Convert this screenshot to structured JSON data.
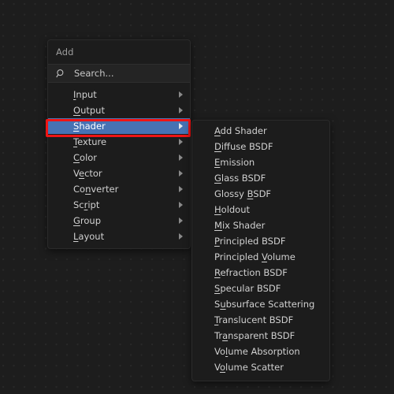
{
  "app": {
    "background_color": "#1d1d1d",
    "accent_color": "#4772b3",
    "highlight_color": "#f01414"
  },
  "add_menu": {
    "title": "Add",
    "search": {
      "icon": "search-icon",
      "placeholder": "Search...",
      "value": "Search..."
    },
    "items": [
      {
        "label": "Input",
        "acc": "I",
        "has_submenu": true,
        "selected": false
      },
      {
        "label": "Output",
        "acc": "O",
        "has_submenu": true,
        "selected": false
      },
      {
        "label": "Shader",
        "acc": "S",
        "has_submenu": true,
        "selected": true
      },
      {
        "label": "Texture",
        "acc": "T",
        "has_submenu": true,
        "selected": false
      },
      {
        "label": "Color",
        "acc": "C",
        "has_submenu": true,
        "selected": false
      },
      {
        "label": "Vector",
        "acc": "e",
        "has_submenu": true,
        "selected": false
      },
      {
        "label": "Converter",
        "acc": "n",
        "has_submenu": true,
        "selected": false
      },
      {
        "label": "Script",
        "acc": "r",
        "has_submenu": true,
        "selected": false
      },
      {
        "label": "Group",
        "acc": "G",
        "has_submenu": true,
        "selected": false
      },
      {
        "label": "Layout",
        "acc": "L",
        "has_submenu": true,
        "selected": false
      }
    ]
  },
  "shader_submenu": {
    "parent": "Shader",
    "items": [
      {
        "label": "Add Shader",
        "acc": "A"
      },
      {
        "label": "Diffuse BSDF",
        "acc": "D"
      },
      {
        "label": "Emission",
        "acc": "E"
      },
      {
        "label": "Glass BSDF",
        "acc": "G"
      },
      {
        "label": "Glossy BSDF",
        "acc": "B"
      },
      {
        "label": "Holdout",
        "acc": "H"
      },
      {
        "label": "Mix Shader",
        "acc": "M"
      },
      {
        "label": "Principled BSDF",
        "acc": "P"
      },
      {
        "label": "Principled Volume",
        "acc": "V"
      },
      {
        "label": "Refraction BSDF",
        "acc": "R"
      },
      {
        "label": "Specular BSDF",
        "acc": "S"
      },
      {
        "label": "Subsurface Scattering",
        "acc": "u"
      },
      {
        "label": "Translucent BSDF",
        "acc": "T"
      },
      {
        "label": "Transparent BSDF",
        "acc": "a"
      },
      {
        "label": "Volume Absorption",
        "acc": "l"
      },
      {
        "label": "Volume Scatter",
        "acc": "o"
      }
    ]
  }
}
